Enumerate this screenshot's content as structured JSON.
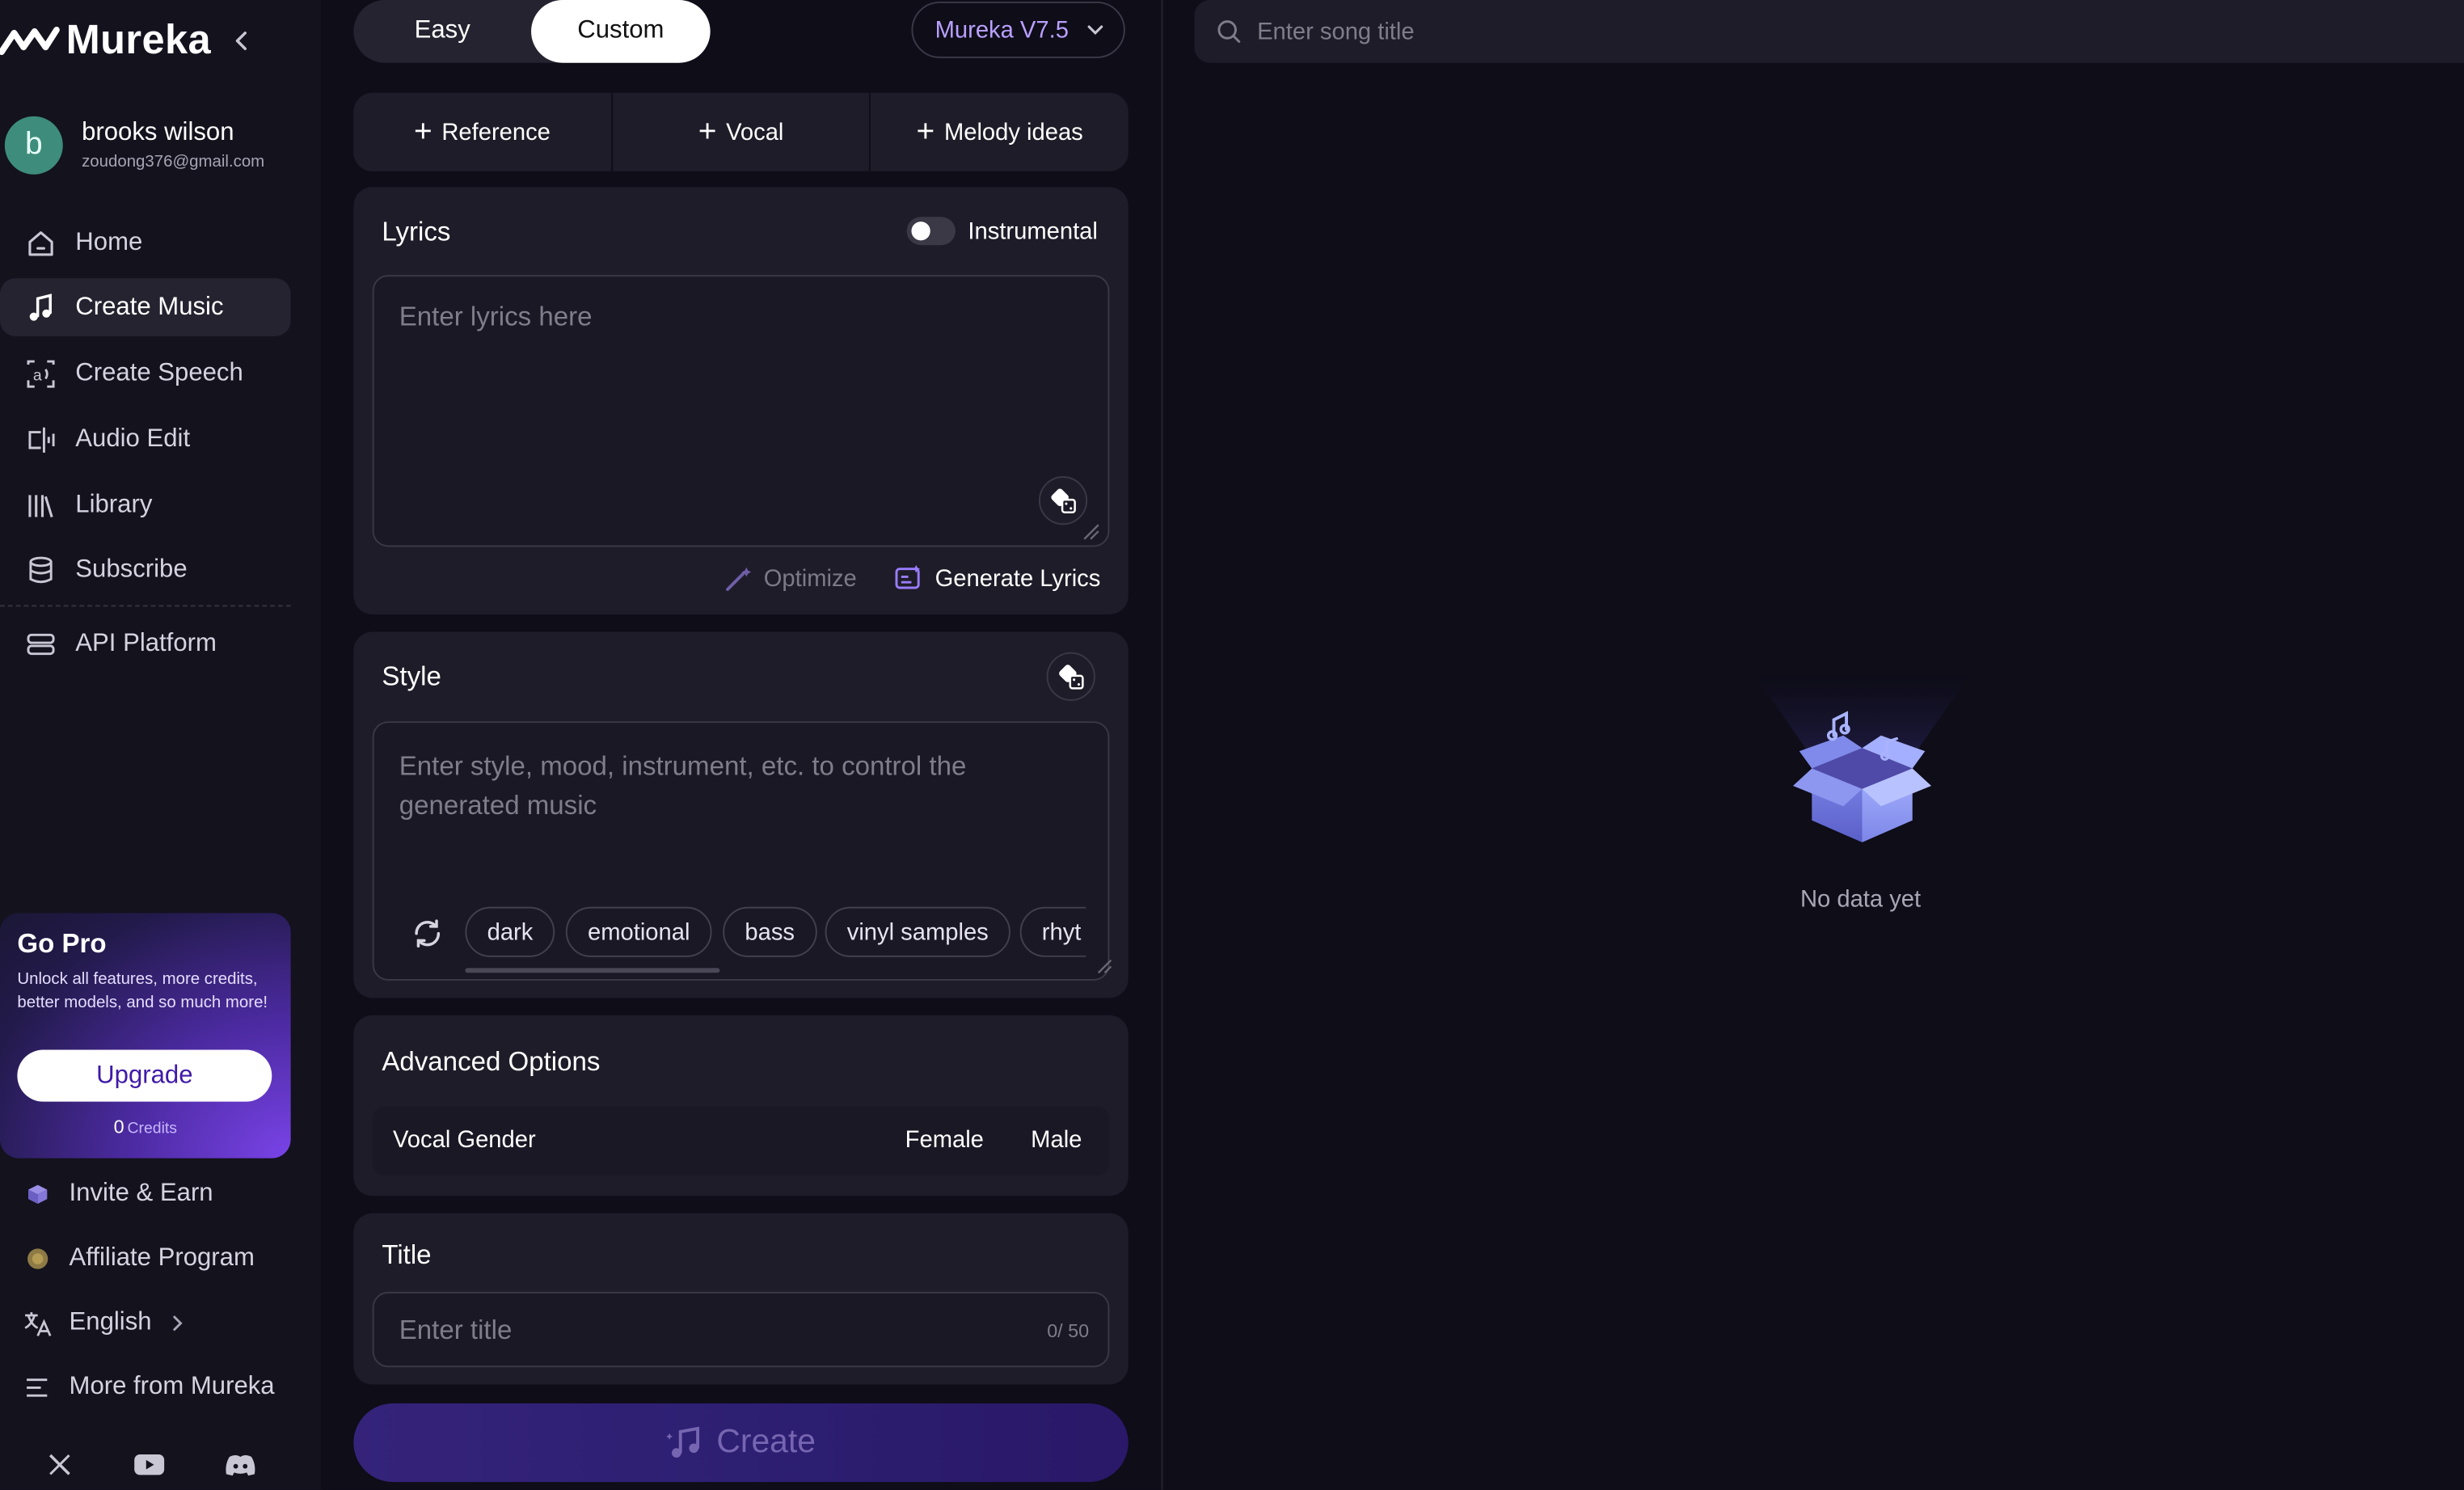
{
  "brand": {
    "name": "Mureka"
  },
  "user": {
    "initial": "b",
    "name": "brooks wilson",
    "email": "zoudong376@gmail.com"
  },
  "nav": [
    {
      "label": "Home",
      "icon": "home-icon"
    },
    {
      "label": "Create Music",
      "icon": "music-note-icon",
      "active": true
    },
    {
      "label": "Create Speech",
      "icon": "speech-icon"
    },
    {
      "label": "Audio Edit",
      "icon": "audio-edit-icon"
    },
    {
      "label": "Library",
      "icon": "library-icon"
    },
    {
      "label": "Subscribe",
      "icon": "database-icon"
    },
    {
      "label": "API Platform",
      "icon": "server-icon"
    }
  ],
  "gopro": {
    "title": "Go Pro",
    "description": "Unlock all features, more credits, better models, and so much more!",
    "button": "Upgrade",
    "credits_value": "0",
    "credits_label": "Credits"
  },
  "bottom_nav": [
    {
      "label": "Invite & Earn",
      "icon": "gift-box-icon"
    },
    {
      "label": "Affiliate Program",
      "icon": "coin-icon"
    },
    {
      "label": "English",
      "icon": "translate-icon"
    },
    {
      "label": "More from Mureka",
      "icon": "menu-icon"
    }
  ],
  "social": [
    "x-icon",
    "youtube-icon",
    "discord-icon"
  ],
  "mode_tabs": {
    "easy": "Easy",
    "custom": "Custom",
    "active": "Custom"
  },
  "model": {
    "selected": "Mureka V7.5"
  },
  "add_buttons": [
    "Reference",
    "Vocal",
    "Melody ideas"
  ],
  "lyrics": {
    "title": "Lyrics",
    "instrumental_label": "Instrumental",
    "instrumental_on": false,
    "placeholder": "Enter lyrics here",
    "optimize": "Optimize",
    "generate": "Generate Lyrics"
  },
  "style": {
    "title": "Style",
    "placeholder_line1": "Enter style, mood, instrument, etc. to control the",
    "placeholder_line2": "generated music",
    "tags": [
      "dark",
      "emotional",
      "bass",
      "vinyl samples",
      "rhyt"
    ]
  },
  "advanced": {
    "title": "Advanced Options",
    "vocal_gender_label": "Vocal Gender",
    "female": "Female",
    "male": "Male"
  },
  "title_field": {
    "title": "Title",
    "placeholder": "Enter title",
    "counter": "0/ 50"
  },
  "create_button": "Create",
  "right_panel": {
    "search_placeholder": "Enter song title",
    "empty_text": "No data yet"
  }
}
